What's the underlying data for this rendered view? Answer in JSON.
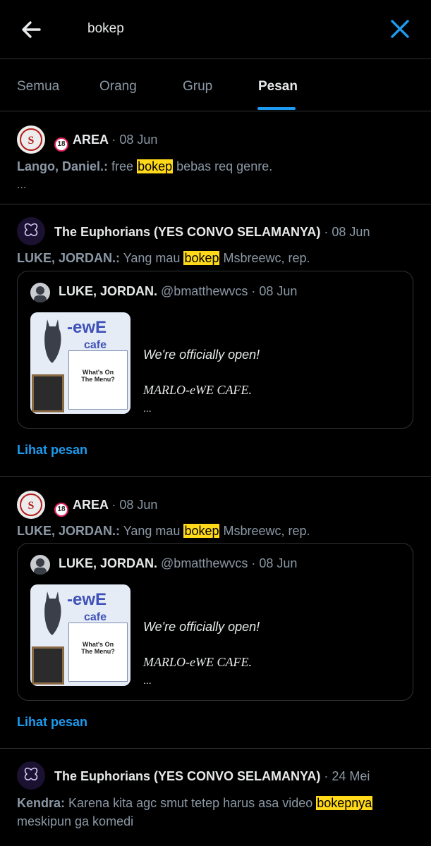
{
  "header": {
    "search_query": "bokep",
    "back_icon": "arrow-left-icon",
    "close_icon": "close-icon",
    "accent": "#1d9bf0"
  },
  "tabs": [
    {
      "label": "Semua",
      "active": false
    },
    {
      "label": "Orang",
      "active": false
    },
    {
      "label": "Grup",
      "active": false
    },
    {
      "label": "Pesan",
      "active": true
    }
  ],
  "results": [
    {
      "group": "AREA",
      "badge": "18",
      "date": "08 Jun",
      "sender": "Lango, Daniel.:",
      "text_before": "free ",
      "highlight": "bokep",
      "text_after": " bebas req genre.",
      "more": "..."
    },
    {
      "group": "The Euphorians (YES CONVO SELAMANYA)",
      "date": "08 Jun",
      "sender": "LUKE, JORDAN.:",
      "text_before": "Yang mau ",
      "highlight": "bokep",
      "text_after": " Msbreewc, rep.",
      "quote": {
        "author": "LUKE, JORDAN.",
        "handle": "@bmatthewvcs",
        "date": "08 Jun",
        "line1": "We're officially open!",
        "line2": "MARLO-eWE CAFE.",
        "line3": "...",
        "thumb_title": "-ewE",
        "thumb_cafe": "cafe",
        "thumb_menu": "What's On The Menu?"
      },
      "link": "Lihat pesan"
    },
    {
      "group": "AREA",
      "badge": "18",
      "date": "08 Jun",
      "sender": "LUKE, JORDAN.:",
      "text_before": "Yang mau ",
      "highlight": "bokep",
      "text_after": " Msbreewc, rep.",
      "quote": {
        "author": "LUKE, JORDAN.",
        "handle": "@bmatthewvcs",
        "date": "08 Jun",
        "line1": "We're officially open!",
        "line2": "MARLO-eWE CAFE.",
        "line3": "...",
        "thumb_title": "-ewE",
        "thumb_cafe": "cafe",
        "thumb_menu": "What's On The Menu?"
      },
      "link": "Lihat pesan"
    },
    {
      "group": "The Euphorians (YES CONVO SELAMANYA)",
      "date": "24 Mei",
      "sender": "Kendra:",
      "text_before": "Karena kita agc smut tetep harus asa video ",
      "highlight": "bokepnya",
      "text_after": " meskipun ga komedi"
    }
  ]
}
